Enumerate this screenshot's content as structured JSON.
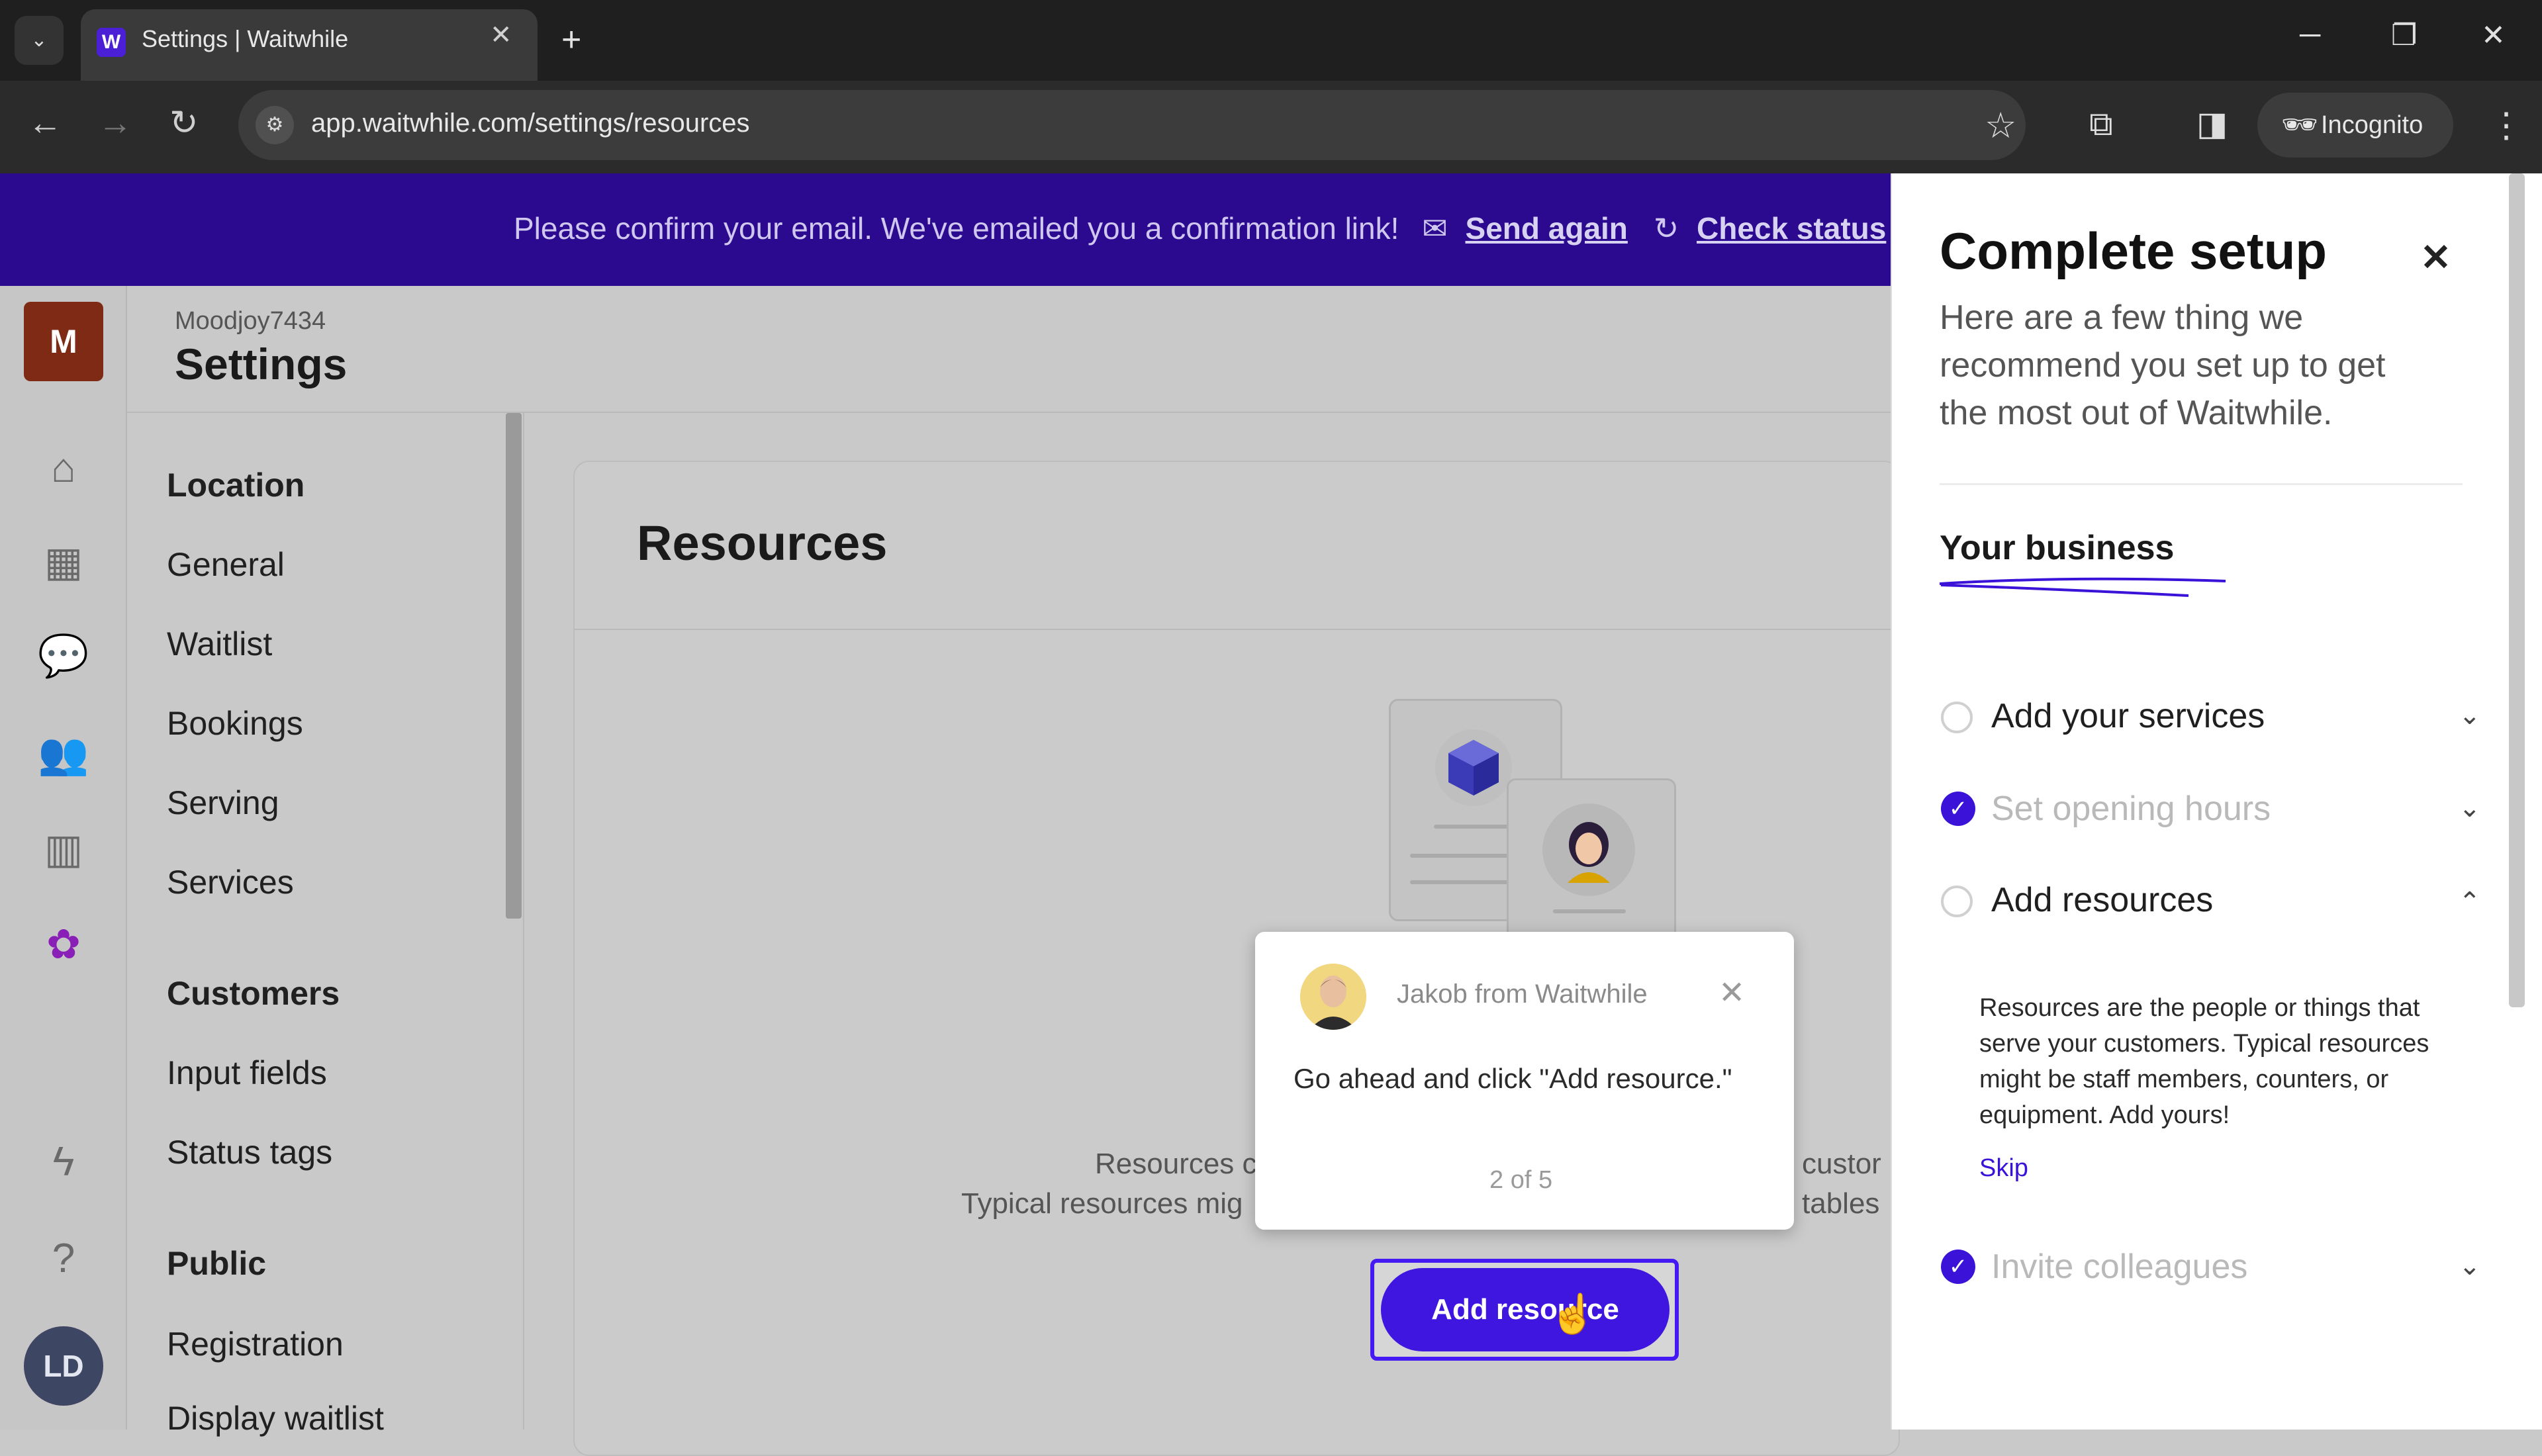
{
  "browser": {
    "tab_title": "Settings | Waitwhile",
    "favicon_letter": "W",
    "url": "app.waitwhile.com/settings/resources",
    "incognito_label": "Incognito"
  },
  "banner": {
    "message": "Please confirm your email. We've emailed you a confirmation link!",
    "send_again": "Send again",
    "check_status": "Check status"
  },
  "rail": {
    "location_initial": "M",
    "user_initials": "LD"
  },
  "header": {
    "location_name": "Moodjoy7434",
    "title": "Settings"
  },
  "settings_nav": {
    "location_heading": "Location",
    "location_items": [
      "General",
      "Waitlist",
      "Bookings",
      "Serving",
      "Services"
    ],
    "customers_heading": "Customers",
    "customers_items": [
      "Input fields",
      "Status tags"
    ],
    "public_heading": "Public",
    "public_items": [
      "Registration",
      "Display waitlist"
    ]
  },
  "content": {
    "title": "Resources",
    "desc_line1_left": "Resources c",
    "desc_line1_right": "custor",
    "desc_line2_left": "Typical resources mig",
    "desc_line2_right": "tables",
    "add_button": "Add resource"
  },
  "tour": {
    "from": "Jakob from Waitwhile",
    "message": "Go ahead and click \"Add resource.\"",
    "step": "2 of 5"
  },
  "panel": {
    "title": "Complete setup",
    "subtitle": "Here are a few thing we recommend you set up to get the most out of Waitwhile.",
    "section": "Your business",
    "steps": [
      {
        "label": "Add your services",
        "done": false
      },
      {
        "label": "Set opening hours",
        "done": true
      },
      {
        "label": "Add resources",
        "done": false
      },
      {
        "label": "Invite colleagues",
        "done": true
      }
    ],
    "resources_desc": "Resources are the people or things that serve your customers. Typical resources might be staff members, counters, or equipment. Add yours!",
    "skip": "Skip"
  },
  "colors": {
    "brand": "#3f16e0",
    "banner": "#2c0a90",
    "location_avatar": "#7e2a14"
  }
}
